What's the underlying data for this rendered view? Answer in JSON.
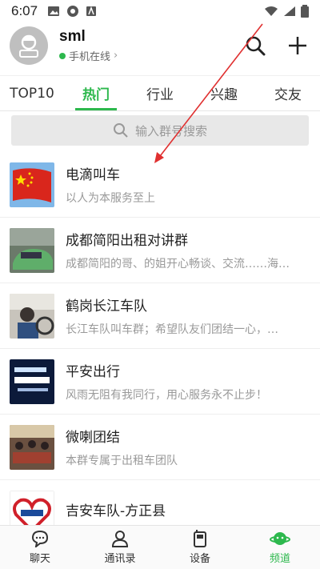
{
  "status_bar": {
    "time": "6:07"
  },
  "header": {
    "username": "sml",
    "online_status": "手机在线",
    "online_chevron": "›"
  },
  "tabs": [
    "TOP10",
    "热门",
    "行业",
    "兴趣",
    "交友"
  ],
  "search": {
    "placeholder": "输入群号搜索"
  },
  "groups": [
    {
      "title": "电滴叫车",
      "desc": "以人为本服务至上"
    },
    {
      "title": "成都简阳出租对讲群",
      "desc": "成都简阳的哥、的姐开心畅谈、交流……海…"
    },
    {
      "title": "鹤岗长江车队",
      "desc": "长江车队叫车群；希望队友们团结一心，…"
    },
    {
      "title": "平安出行",
      "desc": "风雨无阻有我同行，用心服务永不止步！"
    },
    {
      "title": "微喇团结",
      "desc": "本群专属于出租车团队"
    },
    {
      "title": "吉安车队-方正县",
      "desc": ""
    }
  ],
  "bottom_nav": [
    "聊天",
    "通讯录",
    "设备",
    "频道"
  ],
  "colors": {
    "accent": "#2db84d",
    "annotation_arrow": "#e03030"
  }
}
